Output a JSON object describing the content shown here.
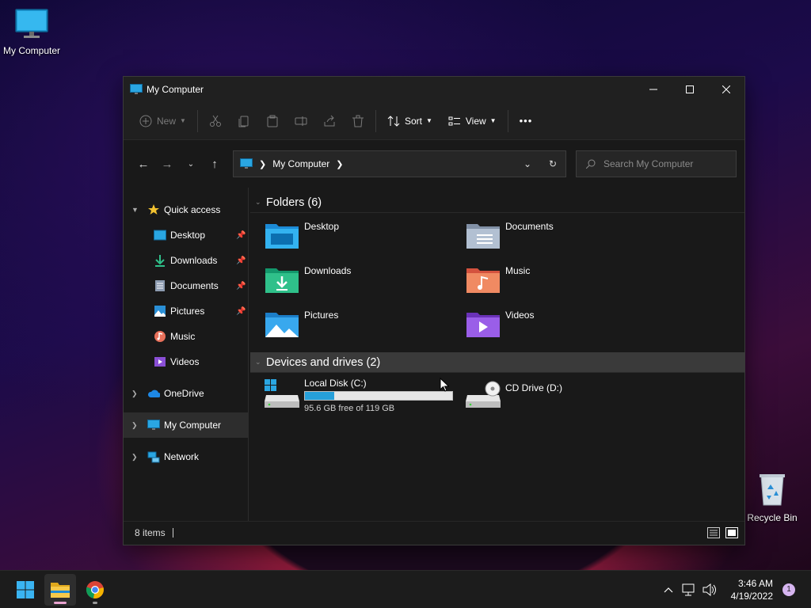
{
  "desktop": {
    "icons": [
      {
        "label": "My Computer"
      },
      {
        "label": "Recycle Bin"
      }
    ]
  },
  "window": {
    "title": "My Computer",
    "controls": {
      "minimize": "minimize",
      "maximize": "maximize",
      "close": "close"
    },
    "toolbar": {
      "new_label": "New",
      "sort_label": "Sort",
      "view_label": "View",
      "more_label": "•••"
    },
    "address": {
      "location": "My Computer"
    },
    "search": {
      "placeholder": "Search My Computer"
    },
    "sidebar": {
      "quick_access": "Quick access",
      "items": [
        {
          "label": "Desktop"
        },
        {
          "label": "Downloads"
        },
        {
          "label": "Documents"
        },
        {
          "label": "Pictures"
        },
        {
          "label": "Music"
        },
        {
          "label": "Videos"
        }
      ],
      "onedrive": "OneDrive",
      "my_computer": "My Computer",
      "network": "Network"
    },
    "content": {
      "folders_header": "Folders (6)",
      "folders": [
        {
          "name": "Desktop"
        },
        {
          "name": "Documents"
        },
        {
          "name": "Downloads"
        },
        {
          "name": "Music"
        },
        {
          "name": "Pictures"
        },
        {
          "name": "Videos"
        }
      ],
      "drives_header": "Devices and drives (2)",
      "drives": [
        {
          "name": "Local Disk (C:)",
          "free_text": "95.6 GB free of 119 GB",
          "used_fraction": 0.2
        },
        {
          "name": "CD Drive (D:)"
        }
      ]
    },
    "status": {
      "items_count": "8 items"
    }
  },
  "taskbar": {
    "clock_time": "3:46 AM",
    "clock_date": "4/19/2022",
    "notification_count": "1"
  },
  "colors": {
    "accent": "#26a0da",
    "window_bg": "#191919",
    "titlebar_bg": "#202020"
  }
}
